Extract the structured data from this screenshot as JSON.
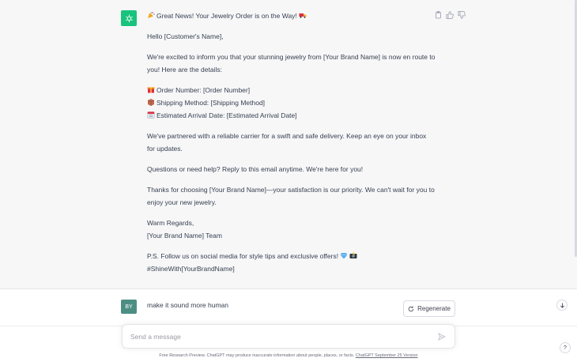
{
  "assistant": {
    "avatar_icon": "openai-logo-icon",
    "accent": "#19c37d",
    "title_line": "Great News! Your Jewelry Order is on the Way!",
    "greeting": "Hello [Customer's Name],",
    "intro": "We're excited to inform you that your stunning jewelry from [Your Brand Name] is now en route to you! Here are the details:",
    "details": [
      {
        "icon": "gift-icon",
        "text": "Order Number: [Order Number]"
      },
      {
        "icon": "package-icon",
        "text": "Shipping Method: [Shipping Method]"
      },
      {
        "icon": "calendar-icon",
        "text": "Estimated Arrival Date: [Estimated Arrival Date]"
      }
    ],
    "carrier": "We've partnered with a reliable carrier for a swift and safe delivery. Keep an eye on your inbox for updates.",
    "questions": "Questions or need help? Reply to this email anytime. We're here for you!",
    "thanks": "Thanks for choosing [Your Brand Name]—your satisfaction is our priority. We can't wait for you to enjoy your new jewelry.",
    "regards": "Warm Regards,",
    "team": "[Your Brand Name] Team",
    "ps": "P.S. Follow us on social media for style tips and exclusive offers!",
    "hashtag": "#ShineWith[YourBrandName]"
  },
  "user": {
    "avatar_initials": "BY",
    "avatar_color": "#4d8e84",
    "message": "make it sound more human"
  },
  "controls": {
    "regenerate_label": "Regenerate",
    "composer_placeholder": "Send a message",
    "help_label": "?"
  },
  "footer": {
    "text": "Free Research Preview. ChatGPT may produce inaccurate information about people, places, or facts.",
    "link": "ChatGPT September 25 Version"
  }
}
